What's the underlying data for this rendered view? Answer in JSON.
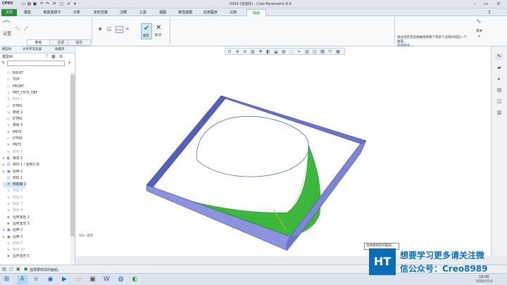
{
  "titlebar": {
    "logo": "CPRO",
    "title": "0303 (活动的) - Creo Parametric 6.0"
  },
  "ribbon_tabs": [
    "文件",
    "模型",
    "制造选择卡",
    "分析",
    "实时仿真",
    "注释",
    "工具",
    "视图",
    "柔性建模",
    "应用程序",
    "公用",
    "曲面"
  ],
  "ribbon": {
    "settings": "设置",
    "ok": "确定",
    "cancel": "取消"
  },
  "dash_tabs": [
    "参考",
    "选项",
    "属性"
  ],
  "message": {
    "text": "通过指定或选择曲线和两个或多个边线扫描出一个曲面。",
    "link": "获取更多..."
  },
  "right_strip": {
    "label": "基本"
  },
  "model_tree": {
    "tabs": [
      "模型树",
      "文件夹浏览器",
      "收藏夹"
    ],
    "header": "模型树",
    "items": [
      {
        "label": "RIGHT",
        "icon": "▱"
      },
      {
        "label": "TOP",
        "icon": "▱"
      },
      {
        "label": "FRONT",
        "icon": "▱"
      },
      {
        "label": "PRT_CSYS_DEF",
        "icon": "⊥"
      },
      {
        "label": "草绘 1",
        "icon": "∿"
      },
      {
        "label": "DTM1",
        "icon": "▱"
      },
      {
        "label": "草绘 2",
        "icon": "∿"
      },
      {
        "label": "DTM2",
        "icon": "▱"
      },
      {
        "label": "草绘 3",
        "icon": "∿"
      },
      {
        "label": "PNT0",
        "icon": "×"
      },
      {
        "label": "DTM3",
        "icon": "▱"
      },
      {
        "label": "PNT1",
        "icon": "×"
      },
      {
        "label": "草绘 4",
        "icon": "∿"
      },
      {
        "label": "填充 1",
        "icon": "◧"
      },
      {
        "label": "阵列 1 / 复制几何",
        "icon": "☰"
      },
      {
        "label": "拉伸 1",
        "icon": "▣"
      },
      {
        "label": "修剪 1",
        "icon": "◫"
      },
      {
        "label": "倒圆角 2",
        "icon": "◔"
      },
      {
        "label": "草绘 5",
        "icon": "∿"
      },
      {
        "label": "草绘 6",
        "icon": "∿"
      },
      {
        "label": "草绘 7",
        "icon": "∿"
      },
      {
        "label": "草绘 8",
        "icon": "∿"
      },
      {
        "label": "边界混合 2",
        "icon": "◈"
      },
      {
        "label": "边界混合 3",
        "icon": "◈"
      },
      {
        "label": "拉伸 2",
        "icon": "▣"
      },
      {
        "label": "拉伸 3",
        "icon": "▣"
      },
      {
        "label": "草绘 9",
        "icon": "∿"
      },
      {
        "label": "草绘 10",
        "icon": "∿"
      },
      {
        "label": "边界混合 5",
        "icon": "◈"
      }
    ]
  },
  "viewport": {
    "label": "SEL: 选项"
  },
  "tooltip": "选择要修剪的面组。",
  "status": {
    "text": "选择要修剪的面组。"
  },
  "taskbar": {
    "clock": "18:08",
    "date": "2020/7/14"
  },
  "watermark": {
    "line1": "想要学习更多请关注微",
    "line2": "信公众号：Creo8989",
    "badge": "HT"
  },
  "colors": {
    "accent": "#2d8a3e",
    "surface": "#3cb83c",
    "frame": "#7d86d4"
  }
}
